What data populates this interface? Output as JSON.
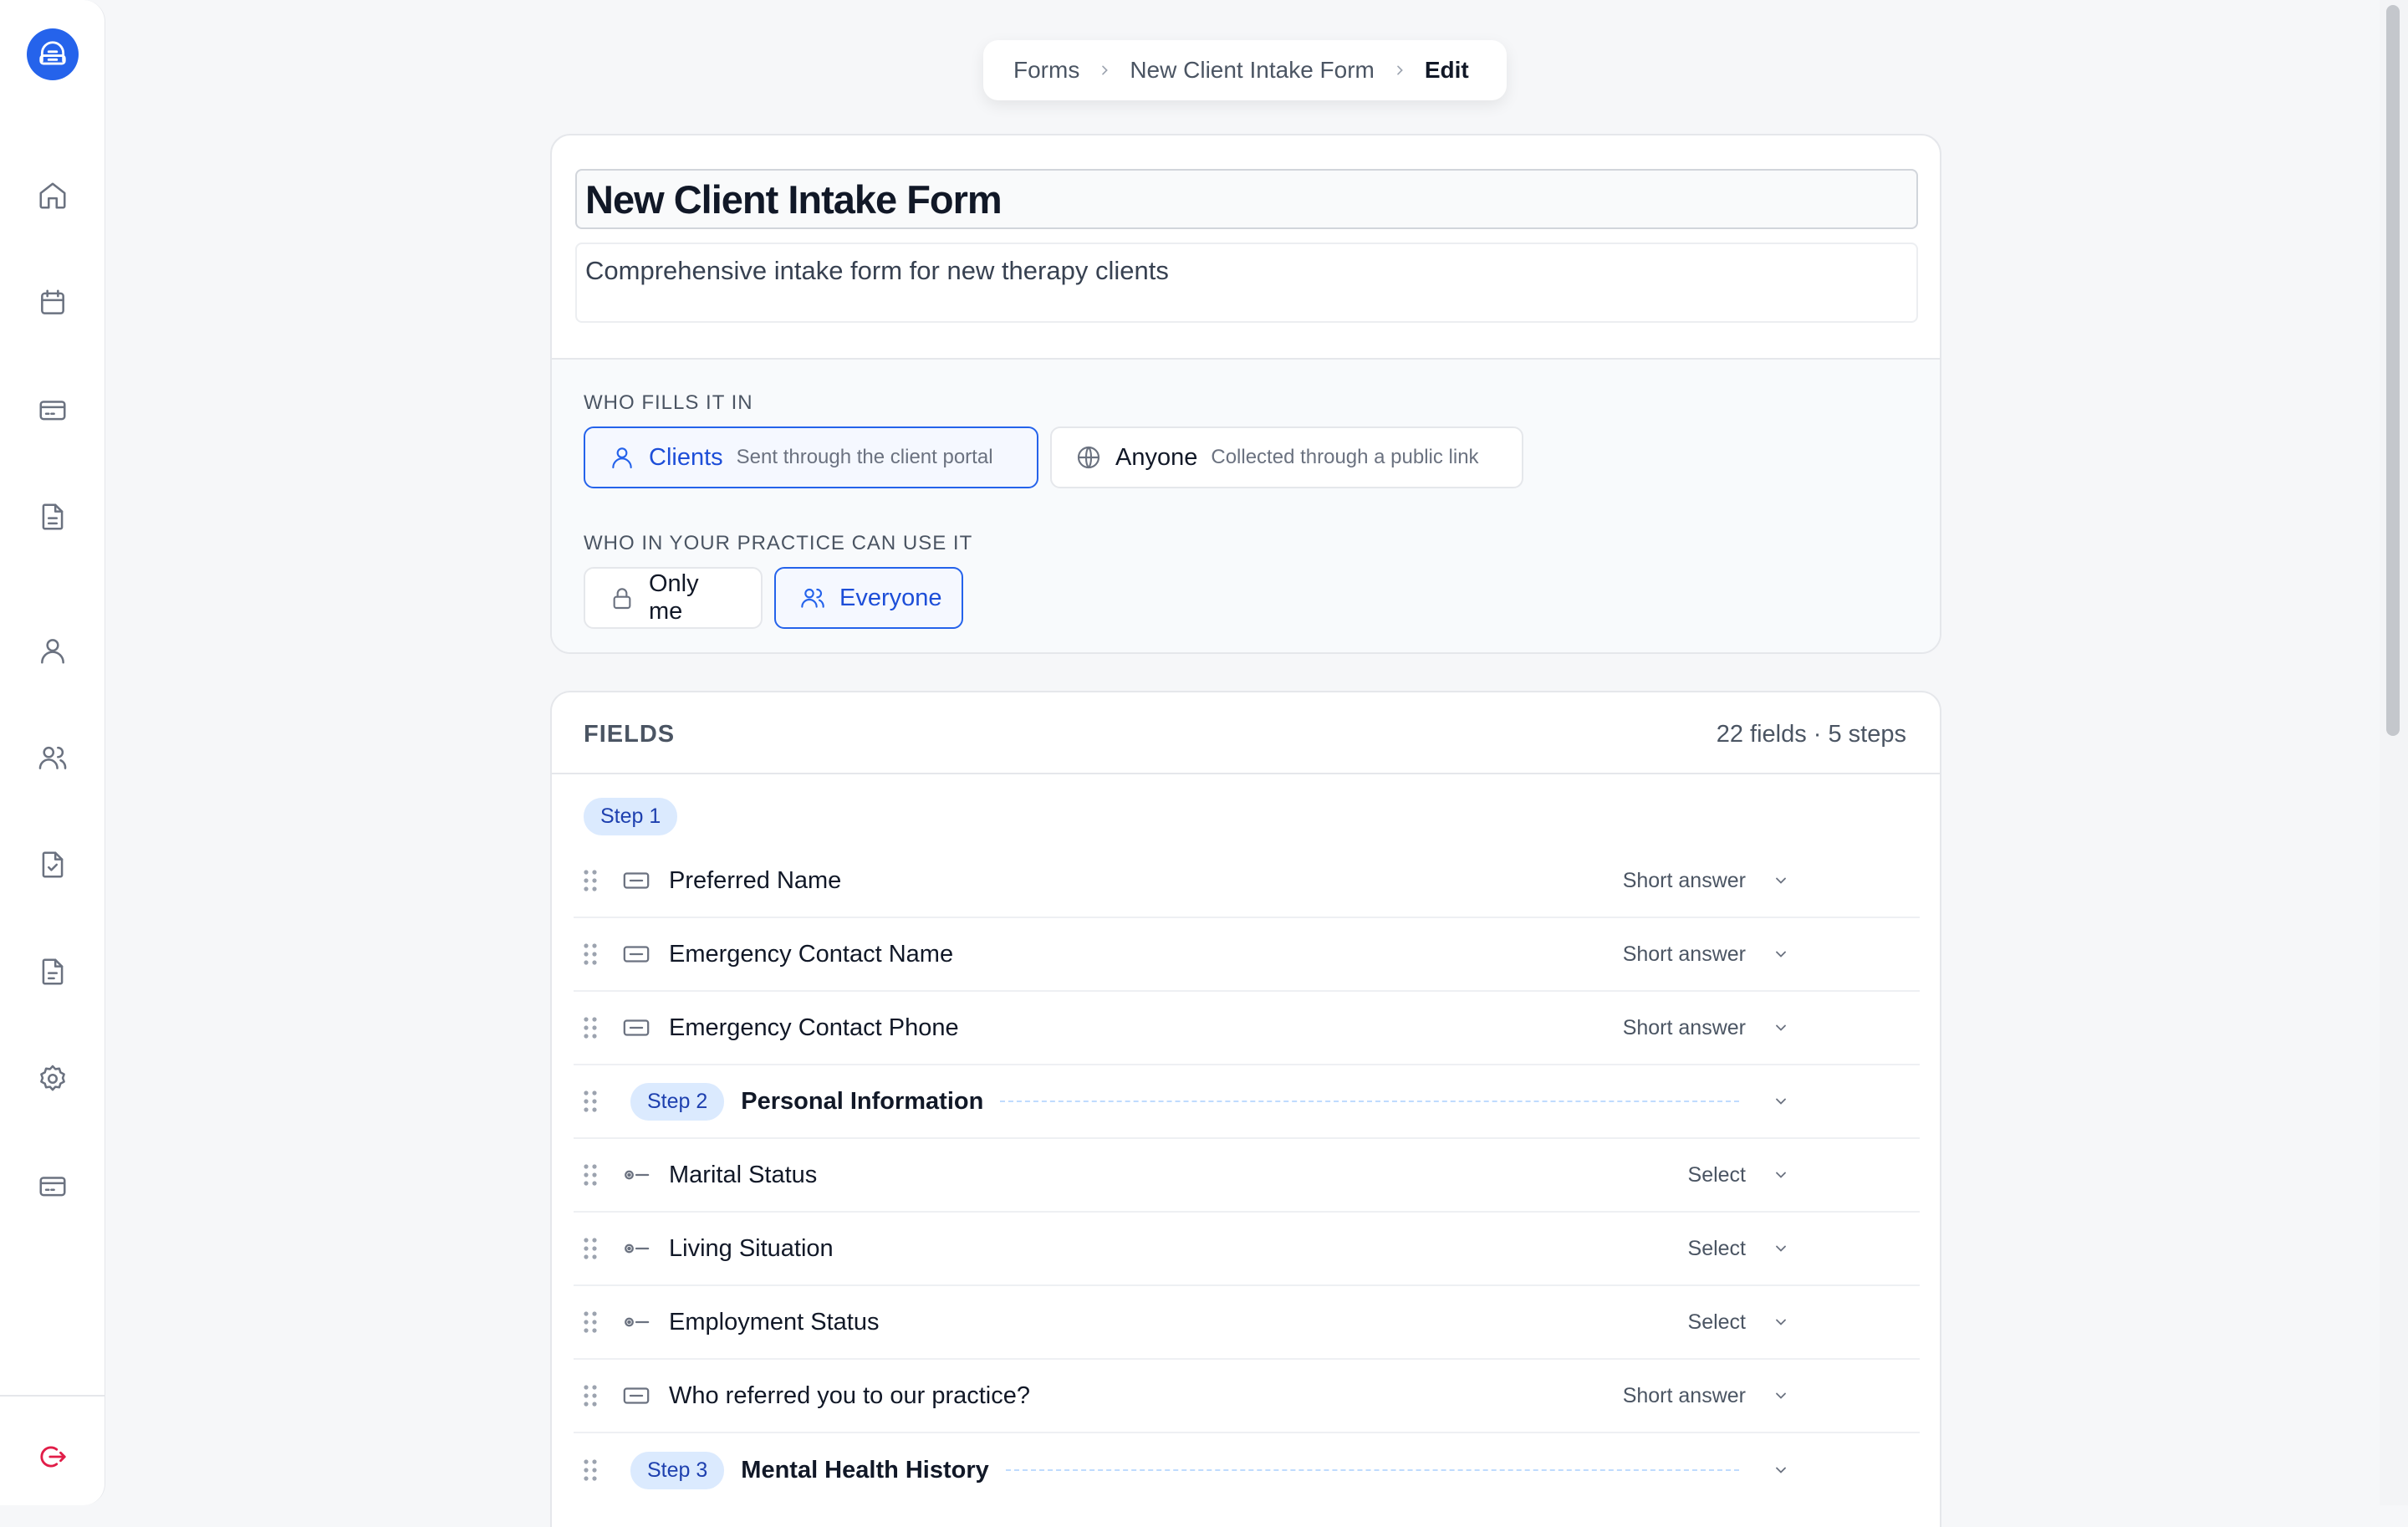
{
  "breadcrumb": {
    "items": [
      "Forms",
      "New Client Intake Form"
    ],
    "current": "Edit"
  },
  "form": {
    "title": "New Client Intake Form",
    "description": "Comprehensive intake form for new therapy clients"
  },
  "fills": {
    "label": "WHO FILLS IT IN",
    "options": [
      {
        "label": "Clients",
        "desc": "Sent through the client portal",
        "icon": "user-icon",
        "selected": true
      },
      {
        "label": "Anyone",
        "desc": "Collected through a public link",
        "icon": "globe-icon",
        "selected": false
      }
    ]
  },
  "access": {
    "label": "WHO IN YOUR PRACTICE CAN USE IT",
    "options": [
      {
        "label": "Only me",
        "icon": "lock-icon",
        "selected": false
      },
      {
        "label": "Everyone",
        "icon": "users-icon",
        "selected": true
      }
    ]
  },
  "fields": {
    "title": "FIELDS",
    "count": "22 fields · 5 steps",
    "step1": "Step 1",
    "rows": [
      {
        "kind": "field",
        "label": "Preferred Name",
        "type": "Short answer",
        "icon": "short-answer-icon"
      },
      {
        "kind": "field",
        "label": "Emergency Contact Name",
        "type": "Short answer",
        "icon": "short-answer-icon"
      },
      {
        "kind": "field",
        "label": "Emergency Contact Phone",
        "type": "Short answer",
        "icon": "short-answer-icon"
      },
      {
        "kind": "step",
        "step": "Step 2",
        "label": "Personal Information"
      },
      {
        "kind": "field",
        "label": "Marital Status",
        "type": "Select",
        "icon": "select-icon"
      },
      {
        "kind": "field",
        "label": "Living Situation",
        "type": "Select",
        "icon": "select-icon"
      },
      {
        "kind": "field",
        "label": "Employment Status",
        "type": "Select",
        "icon": "select-icon"
      },
      {
        "kind": "field",
        "label": "Who referred you to our practice?",
        "type": "Short answer",
        "icon": "short-answer-icon"
      },
      {
        "kind": "step",
        "step": "Step 3",
        "label": "Mental Health History"
      }
    ]
  },
  "colors": {
    "accent": "#2563eb",
    "logout": "#e11d48"
  }
}
